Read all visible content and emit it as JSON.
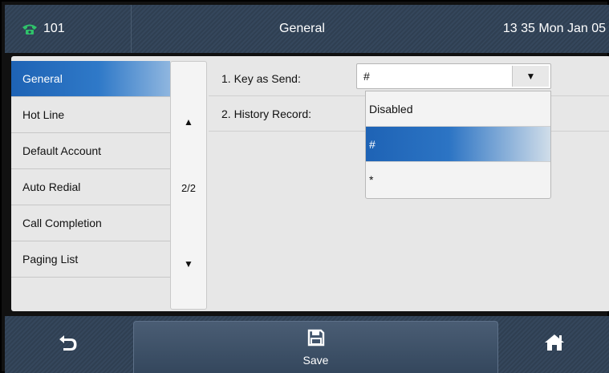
{
  "status_bar": {
    "account": "101",
    "title": "General",
    "clock": "13 35 Mon Jan 05"
  },
  "menu": {
    "items": [
      {
        "label": "General",
        "selected": true
      },
      {
        "label": "Hot Line"
      },
      {
        "label": "Default Account"
      },
      {
        "label": "Auto Redial"
      },
      {
        "label": "Call Completion"
      },
      {
        "label": "Paging List"
      }
    ]
  },
  "scroll": {
    "page": "2/2",
    "up_icon": "▲",
    "down_icon": "▼"
  },
  "settings": [
    {
      "label": "1. Key as Send:",
      "value": "#"
    },
    {
      "label": "2. History Record:"
    }
  ],
  "dropdown": {
    "arrow_icon": "▼",
    "options": [
      "Disabled",
      "#",
      "*"
    ],
    "selected": "#"
  },
  "softkeys": {
    "back_icon": "back-arrow-icon",
    "save_label": "Save",
    "save_icon": "floppy-disk-icon",
    "home_icon": "home-icon"
  },
  "colors": {
    "status_bar": "#2f3f52",
    "selected_blue": "#1e63b5",
    "phone_green": "#2fc26a"
  }
}
